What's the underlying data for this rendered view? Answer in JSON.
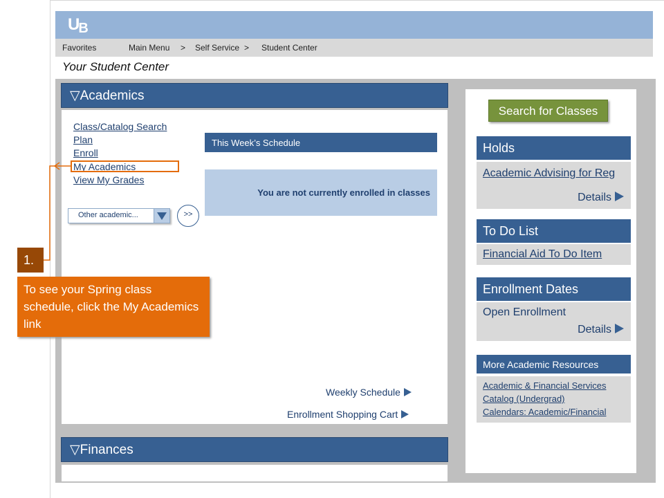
{
  "banner": {
    "logo_u": "U",
    "logo_b": "B"
  },
  "nav": {
    "favorites": "Favorites",
    "main_menu": "Main Menu",
    "sep1": ">",
    "self_service": "Self Service",
    "sep2": ">",
    "student_center": "Student Center"
  },
  "page_title": "Your Student Center",
  "academics": {
    "header": "▽Academics",
    "links": [
      "Class/Catalog Search",
      "Plan",
      "Enroll",
      "My Academics",
      "View My Grades"
    ],
    "schedule_header": "This Week’s Schedule",
    "schedule_message": "You are not currently enrolled in classes",
    "select_value": "Other academic...",
    "go_label": ">>",
    "weekly_schedule": "Weekly Schedule",
    "shopping_cart": "Enrollment Shopping Cart"
  },
  "finances": {
    "header": "▽Finances"
  },
  "sidebar": {
    "search_button": "Search for Classes",
    "holds": {
      "header": "Holds",
      "item": "Academic  Advising for Reg",
      "details": "Details"
    },
    "todo": {
      "header": "To Do List",
      "item": "Financial Aid To Do Item"
    },
    "enrollment": {
      "header": "Enrollment Dates",
      "item": "Open Enrollment",
      "details": "Details"
    },
    "resources": {
      "header": "More Academic Resources",
      "links": [
        "Academic & Financial Services",
        "Catalog (Undergrad)",
        "Calendars: Academic/Financial"
      ]
    }
  },
  "callout": {
    "number": "1.",
    "text": "To see your Spring class schedule, click the My Academics link"
  },
  "colors": {
    "banner": "#95b3d7",
    "header": "#376092",
    "search_button": "#77933c",
    "callout": "#e46c0a",
    "callout_number": "#974806"
  }
}
